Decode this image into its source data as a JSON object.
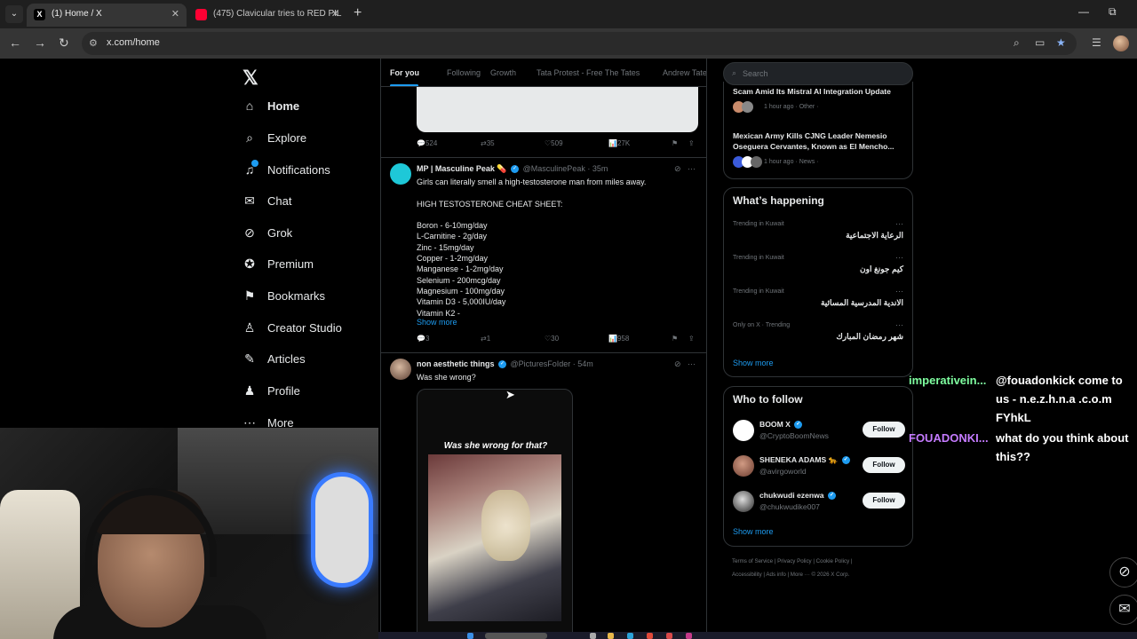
{
  "browser": {
    "tabs": [
      {
        "title": "(1) Home / X",
        "active": true
      },
      {
        "title": "(475) Clavicular tries to RED PIL",
        "active": false
      }
    ],
    "url": "x.com/home"
  },
  "sidebar": {
    "items": [
      {
        "label": "Home",
        "icon": "home-icon"
      },
      {
        "label": "Explore",
        "icon": "search-icon"
      },
      {
        "label": "Notifications",
        "icon": "bell-icon"
      },
      {
        "label": "Chat",
        "icon": "mail-icon"
      },
      {
        "label": "Grok",
        "icon": "grok-icon"
      },
      {
        "label": "Premium",
        "icon": "premium-icon"
      },
      {
        "label": "Bookmarks",
        "icon": "bookmark-icon"
      },
      {
        "label": "Creator Studio",
        "icon": "creator-icon"
      },
      {
        "label": "Articles",
        "icon": "articles-icon"
      },
      {
        "label": "Profile",
        "icon": "profile-icon"
      },
      {
        "label": "More",
        "icon": "more-icon"
      }
    ]
  },
  "feed": {
    "tabs": [
      "For you",
      "Following",
      "Growth",
      "Tata Protest - Free The Tates",
      "Andrew Tate"
    ],
    "top_tweet_stats": {
      "replies": "524",
      "reposts": "35",
      "likes": "509",
      "views": "27K"
    },
    "tweets": [
      {
        "name": "MP | Masculine Peak",
        "handle": "@MasculinePeak",
        "time": "· 35m",
        "lines": [
          "Girls can literally smell a high-testosterone man from miles away.",
          "",
          "HIGH TESTOSTERONE CHEAT SHEET:",
          "",
          "Boron - 6-10mg/day",
          "L-Carnitine - 2g/day",
          "Zinc - 15mg/day",
          "Copper - 1-2mg/day",
          "Manganese - 1-2mg/day",
          "Selenium - 200mcg/day",
          "Magnesium - 100mg/day",
          "Vitamin D3 - 5,000IU/day",
          "Vitamin K2 -"
        ],
        "show_more": "Show more",
        "stats": {
          "replies": "3",
          "reposts": "1",
          "likes": "30",
          "views": "958"
        }
      },
      {
        "name": "non aesthetic things",
        "handle": "@PicturesFoIder",
        "time": "· 54m",
        "text": "Was she wrong?",
        "video_caption": "Was she wrong for that?"
      }
    ]
  },
  "right": {
    "search_placeholder": "Search",
    "news": [
      {
        "title": "Scam Amid Its Mistral AI Integration Update",
        "meta": "1 hour ago · Other ·"
      },
      {
        "title": "Mexican Army Kills CJNG Leader Nemesio Oseguera Cervantes, Known as El Mencho...",
        "meta": "1 hour ago · News ·"
      }
    ],
    "whats_happening": {
      "heading": "What’s happening",
      "trends": [
        {
          "meta": "Trending in Kuwait",
          "name": "الرعاية الاجتماعية"
        },
        {
          "meta": "Trending in Kuwait",
          "name": "كيم جونغ اون"
        },
        {
          "meta": "Trending in Kuwait",
          "name": "الاندية المدرسية المسائية"
        },
        {
          "meta": "Only on X · Trending",
          "name": "شهر رمضان المبارك"
        }
      ],
      "show_more": "Show more"
    },
    "who_to_follow": {
      "heading": "Who to follow",
      "users": [
        {
          "name": "BOOM X",
          "handle": "@CryptoBoomNews",
          "button": "Follow"
        },
        {
          "name": "SHENEKA ADAMS 🐆",
          "handle": "@avirgoworld",
          "button": "Follow"
        },
        {
          "name": "chukwudi ezenwa",
          "handle": "@chukwudike007",
          "button": "Follow"
        }
      ],
      "show_more": "Show more"
    },
    "footer": {
      "line1": "Terms of Service  |  Privacy Policy  |  Cookie Policy  |",
      "line2": "Accessibility  |  Ads info  |  More ···  © 2026 X Corp."
    }
  },
  "stream_chat": [
    {
      "user": "imperativein...",
      "message": "@fouadonkick come to us - n.e.z.h.n.a .c.o.m FYhkL",
      "color": "#7fffa0"
    },
    {
      "user": "FOUADONKI...",
      "message": "what do you think about this??",
      "color": "#c57bff"
    }
  ],
  "colors": {
    "accent": "#1d9bf0",
    "background": "#000000",
    "border": "#2f3336",
    "muted": "#71767b"
  }
}
